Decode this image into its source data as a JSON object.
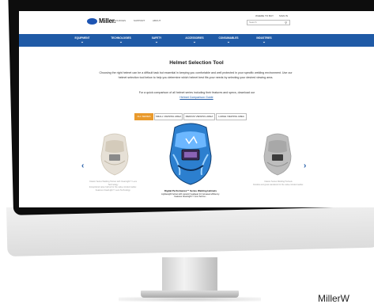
{
  "header": {
    "logo": "Miller.",
    "nav_small": [
      "RESOURCES",
      "SUPPORT",
      "ABOUT"
    ],
    "right_links": [
      "WHERE TO BUY",
      "SIGN IN"
    ],
    "search_placeholder": "Search"
  },
  "navbar": [
    "EQUIPMENT",
    "TECHNOLOGIES",
    "SAFETY",
    "ACCESSORIES",
    "CONSUMABLES",
    "INDUSTRIES"
  ],
  "page": {
    "title": "Helmet Selection Tool",
    "intro": "Choosing the right helmet can be a difficult task but essential in keeping you comfortable and well protected in your specific welding environment. Use our helmet selection tool below to help you determine which helmet best fits your needs by selecting your desired viewing area.",
    "compare_text": "For a quick comparison of all helmet series including their features and specs, download our",
    "compare_link": "Helmet Comparison Guide"
  },
  "tabs": [
    "ALL SERIES",
    "SMALL VIEWING AREA",
    "MEDIUM VIEWING AREA",
    "LARGE VIEWING AREA"
  ],
  "carousel": {
    "items": [
      {
        "caption": "Classic Series Welding Helmet with ClearLight™ Lens Technology",
        "subcaption": "Exceptional value helmet for the value-minded welder. Features ClearLight™ Lens Technology."
      },
      {
        "caption": "Digital Performance™ Series Welding Helmets",
        "subcaption": "Lightweight helmet with superior headgear for increased efficiency. Features ClearLight™ Lens Techno..."
      },
      {
        "caption": "Classic Series Welding Helmets",
        "subcaption": "Durable and great standards for the value-minded welder."
      }
    ]
  },
  "brand_caption": "MillerW"
}
